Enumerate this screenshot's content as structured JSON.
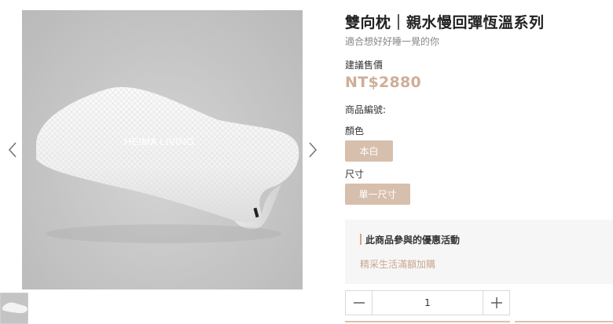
{
  "gallery": {
    "watermark": "HEIMA LIVING",
    "icons": {
      "prev": "chevron-left-icon",
      "next": "chevron-right-icon"
    }
  },
  "product": {
    "title": "雙向枕｜親水慢回彈恆溫系列",
    "subtitle": "適合想好好睡一覺的你",
    "price_label": "建議售價",
    "price": "NT$2880",
    "sku_label": "商品編號:",
    "color_label": "顏色",
    "color_option": "本白",
    "size_label": "尺寸",
    "size_option": "單一尺寸"
  },
  "promo": {
    "title": "此商品參與的優惠活動",
    "link": "精采生活滿額加購"
  },
  "quantity": {
    "value": "1",
    "icons": {
      "minus": "minus-icon",
      "plus": "plus-icon"
    }
  },
  "colors": {
    "accent": "#cfae98",
    "option_bg": "#d7bfad",
    "promo_bg": "#f6f6f6"
  }
}
